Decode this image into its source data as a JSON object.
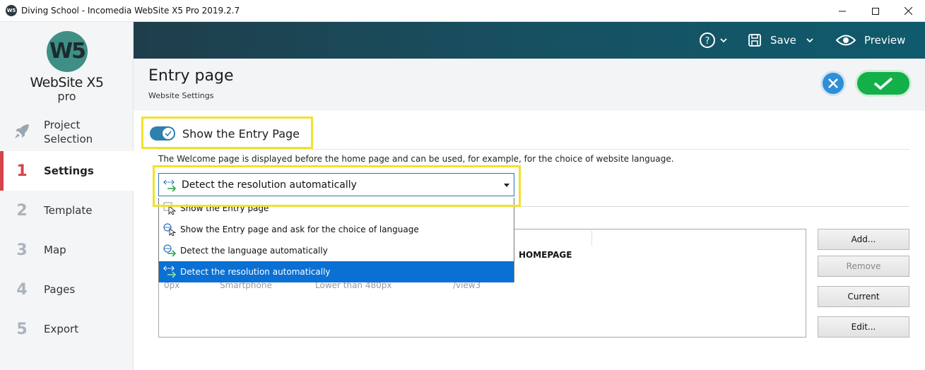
{
  "window": {
    "title": "Diving School - Incomedia WebSite X5 Pro 2019.2.7",
    "icon_text": "W5"
  },
  "logo": {
    "mark": "W5",
    "name": "WebSite X5",
    "edition": "pro"
  },
  "sidebar": {
    "items": [
      {
        "num": "",
        "label": "Project Selection",
        "icon": "rocket-icon"
      },
      {
        "num": "1",
        "label": "Settings"
      },
      {
        "num": "2",
        "label": "Template"
      },
      {
        "num": "3",
        "label": "Map"
      },
      {
        "num": "4",
        "label": "Pages"
      },
      {
        "num": "5",
        "label": "Export"
      }
    ],
    "active_index": 1
  },
  "toolbar": {
    "help_icon": "help-icon",
    "save_label": "Save",
    "preview_label": "Preview"
  },
  "header": {
    "title": "Entry page",
    "subtitle": "Website Settings"
  },
  "main": {
    "toggle_label": "Show the Entry Page",
    "toggle_on": true,
    "description": "The Welcome page is displayed before the home page and can be used, for example, for the choice of website language.",
    "select_value": "Detect the resolution automatically",
    "dropdown_options": [
      {
        "label": "Show the Entry page",
        "icon": "cursor-page-icon"
      },
      {
        "label": "Show the Entry page and ask for the choice of language",
        "icon": "globe-cursor-icon"
      },
      {
        "label": "Detect the language automatically",
        "icon": "globe-arrow-icon"
      },
      {
        "label": "Detect the resolution automatically",
        "icon": "resolution-arrow-icon",
        "selected": true
      }
    ],
    "table": {
      "visible_header": "HOMEPAGE",
      "row": [
        "0px",
        "Smartphone",
        "Lower than 480px",
        "/view3"
      ]
    },
    "buttons": {
      "add": "Add...",
      "remove": "Remove",
      "current": "Current",
      "edit": "Edit..."
    }
  },
  "colors": {
    "accent_red": "#d4444a",
    "topbar": "#165263",
    "ok_green": "#13b04a",
    "cancel_blue": "#2f8fd6",
    "highlight_yellow": "#f1e12d",
    "selection_blue": "#0a70d4"
  }
}
